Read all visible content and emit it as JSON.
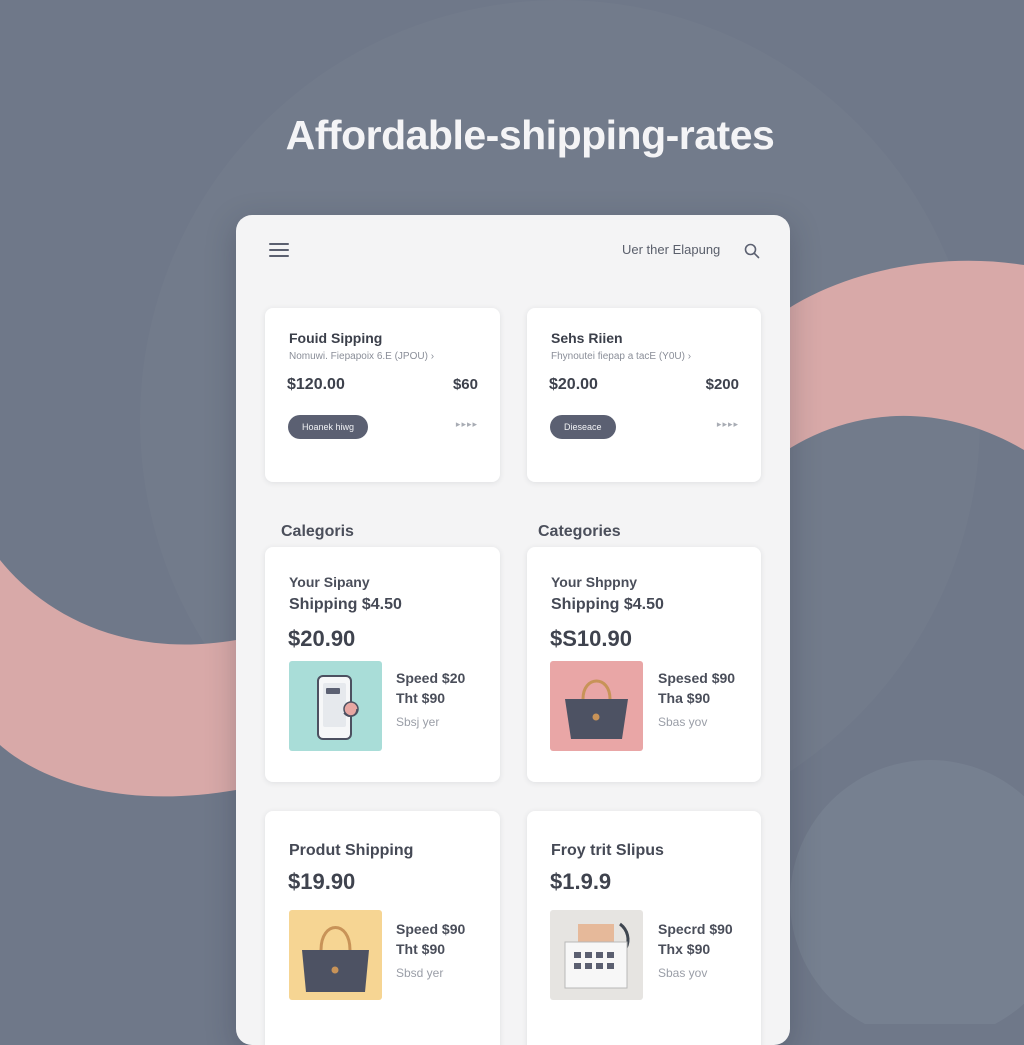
{
  "headline": "Affordable-shipping-rates",
  "topbar": {
    "link_label": "Uer ther Elapung"
  },
  "shipping_cards": [
    {
      "title": "Fouid Sipping",
      "subtitle": "Nomuwi. Fiepapoix 6.E (JPOU) ›",
      "price": "$120.00",
      "secondary_price": "$60",
      "button_label": "Hoanek hiwg",
      "more": "▸▸▸▸"
    },
    {
      "title": "Sehs Riien",
      "subtitle": "Fhynoutei fiepap a tacE (Y0U) ›",
      "price": "$20.00",
      "secondary_price": "$200",
      "button_label": "Dieseace",
      "more": "▸▸▸▸"
    }
  ],
  "sections": {
    "left_label": "Calegoris",
    "right_label": "Categories"
  },
  "category_cards": [
    {
      "line1": "Your Sipany",
      "line2": "Shipping $4.50",
      "price": "$20.90",
      "speed": "Speed $20",
      "tint": "Tht $90",
      "note": "Sbsj yer",
      "image_icon": "phone-icon",
      "image_bg": "#a9ddd8"
    },
    {
      "line1": "Your Shppny",
      "line2": "Shipping $4.50",
      "price": "$S10.90",
      "speed": "Spesed $90",
      "tint": "Tha $90",
      "note": "Sbas yov",
      "image_icon": "bag-icon",
      "image_bg": "#e9a6a6"
    },
    {
      "title": "Produt Shipping",
      "price": "$19.90",
      "speed": "Speed $90",
      "tint": "Tht $90",
      "note": "Sbsd yer",
      "image_icon": "bag-icon",
      "image_bg": "#f6d593"
    },
    {
      "title": "Froy trit Slipus",
      "price": "$1.9.9",
      "speed": "Specrd $90",
      "tint": "Thx $90",
      "note": "Sbas yov",
      "image_icon": "box-icon",
      "image_bg": "#e6e4e1"
    }
  ],
  "colors": {
    "background": "#6f7889",
    "accent_pink": "#d8a8a8",
    "button": "#5b6072"
  }
}
